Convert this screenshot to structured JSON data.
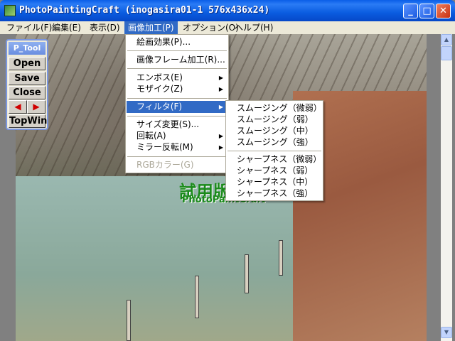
{
  "window": {
    "title": "PhotoPaintingCraft  (inogasira01-1  576x436x24)",
    "minimize_glyph": "_",
    "maximize_glyph": "□",
    "close_glyph": "✕"
  },
  "menubar": {
    "items": [
      {
        "label": "ファイル(F)"
      },
      {
        "label": "編集(E)"
      },
      {
        "label": "表示(D)"
      },
      {
        "label": "画像加工(P)"
      },
      {
        "label": "オプション(O)"
      },
      {
        "label": "ヘルプ(H)"
      }
    ]
  },
  "image_menu": {
    "items": [
      {
        "label": "絵画効果(P)..."
      },
      {
        "label": "画像フレーム加工(R)..."
      },
      {
        "label": "エンボス(E)"
      },
      {
        "label": "モザイク(Z)"
      },
      {
        "label": "フィルタ(F)"
      },
      {
        "label": "サイズ変更(S)..."
      },
      {
        "label": "回転(A)"
      },
      {
        "label": "ミラー反転(M)"
      },
      {
        "label": "RGBカラー(G)"
      }
    ],
    "submenu_glyph": "▶"
  },
  "filter_submenu": {
    "items": [
      {
        "label": "スムージング（微弱）"
      },
      {
        "label": "スムージング（弱）"
      },
      {
        "label": "スムージング（中）"
      },
      {
        "label": "スムージング（強）"
      },
      {
        "label": "シャープネス（微弱）"
      },
      {
        "label": "シャープネス（弱）"
      },
      {
        "label": "シャープネス（中）"
      },
      {
        "label": "シャープネス（強）"
      }
    ]
  },
  "ptool": {
    "title": "P_Tool",
    "open": "Open",
    "save": "Save",
    "close": "Close",
    "prev_glyph": "◀",
    "next_glyph": "▶",
    "topwin": "TopWin"
  },
  "watermark": {
    "main": "試用版",
    "sub": "PhotoPaintCraft"
  },
  "scrollbar": {
    "up_glyph": "▲",
    "down_glyph": "▼"
  }
}
